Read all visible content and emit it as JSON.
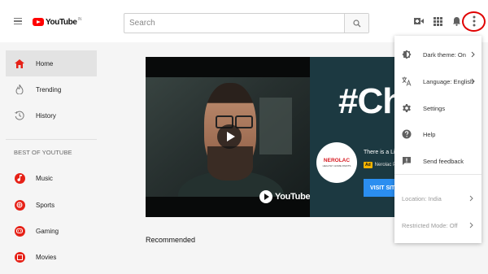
{
  "header": {
    "logo_text": "YouTube",
    "logo_region": "IN",
    "search_placeholder": "Search",
    "icons": [
      "hamburger-icon",
      "search-icon",
      "create-video-icon",
      "apps-icon",
      "notifications-icon",
      "more-vert-icon"
    ]
  },
  "sidebar": {
    "items": [
      {
        "label": "Home",
        "icon": "home-icon"
      },
      {
        "label": "Trending",
        "icon": "trending-icon"
      },
      {
        "label": "History",
        "icon": "history-icon"
      }
    ],
    "section_title": "BEST OF YOUTUBE",
    "best_of": [
      {
        "label": "Music",
        "icon": "music-icon"
      },
      {
        "label": "Sports",
        "icon": "sports-icon"
      },
      {
        "label": "Gaming",
        "icon": "gaming-icon"
      },
      {
        "label": "Movies",
        "icon": "movies-icon"
      }
    ]
  },
  "main": {
    "video_watermark": "YouTube",
    "ad": {
      "headline": "#Cha",
      "brand_name": "NEROLAC",
      "brand_tagline": "HEALTHY HOME PAINTS",
      "title": "There is a Lit",
      "badge": "Ad",
      "advertiser": "Nerolac P",
      "cta": "VISIT SITE"
    },
    "recommended_label": "Recommended"
  },
  "menu": {
    "items": [
      {
        "label": "Dark theme: On",
        "icon": "dark-theme-icon",
        "chevron": true
      },
      {
        "label": "Language: English",
        "icon": "language-icon",
        "chevron": true
      },
      {
        "label": "Settings",
        "icon": "settings-icon",
        "chevron": false
      },
      {
        "label": "Help",
        "icon": "help-icon",
        "chevron": false
      },
      {
        "label": "Send feedback",
        "icon": "feedback-icon",
        "chevron": false
      }
    ],
    "footer_items": [
      {
        "label": "Location: India",
        "chevron": true
      },
      {
        "label": "Restricted Mode: Off",
        "chevron": true
      }
    ]
  },
  "colors": {
    "brand_red": "#ff0000",
    "highlight_circle": "#e00000",
    "sidebar_bg": "#f5f5f5",
    "cta_blue": "#2b8ef0"
  }
}
